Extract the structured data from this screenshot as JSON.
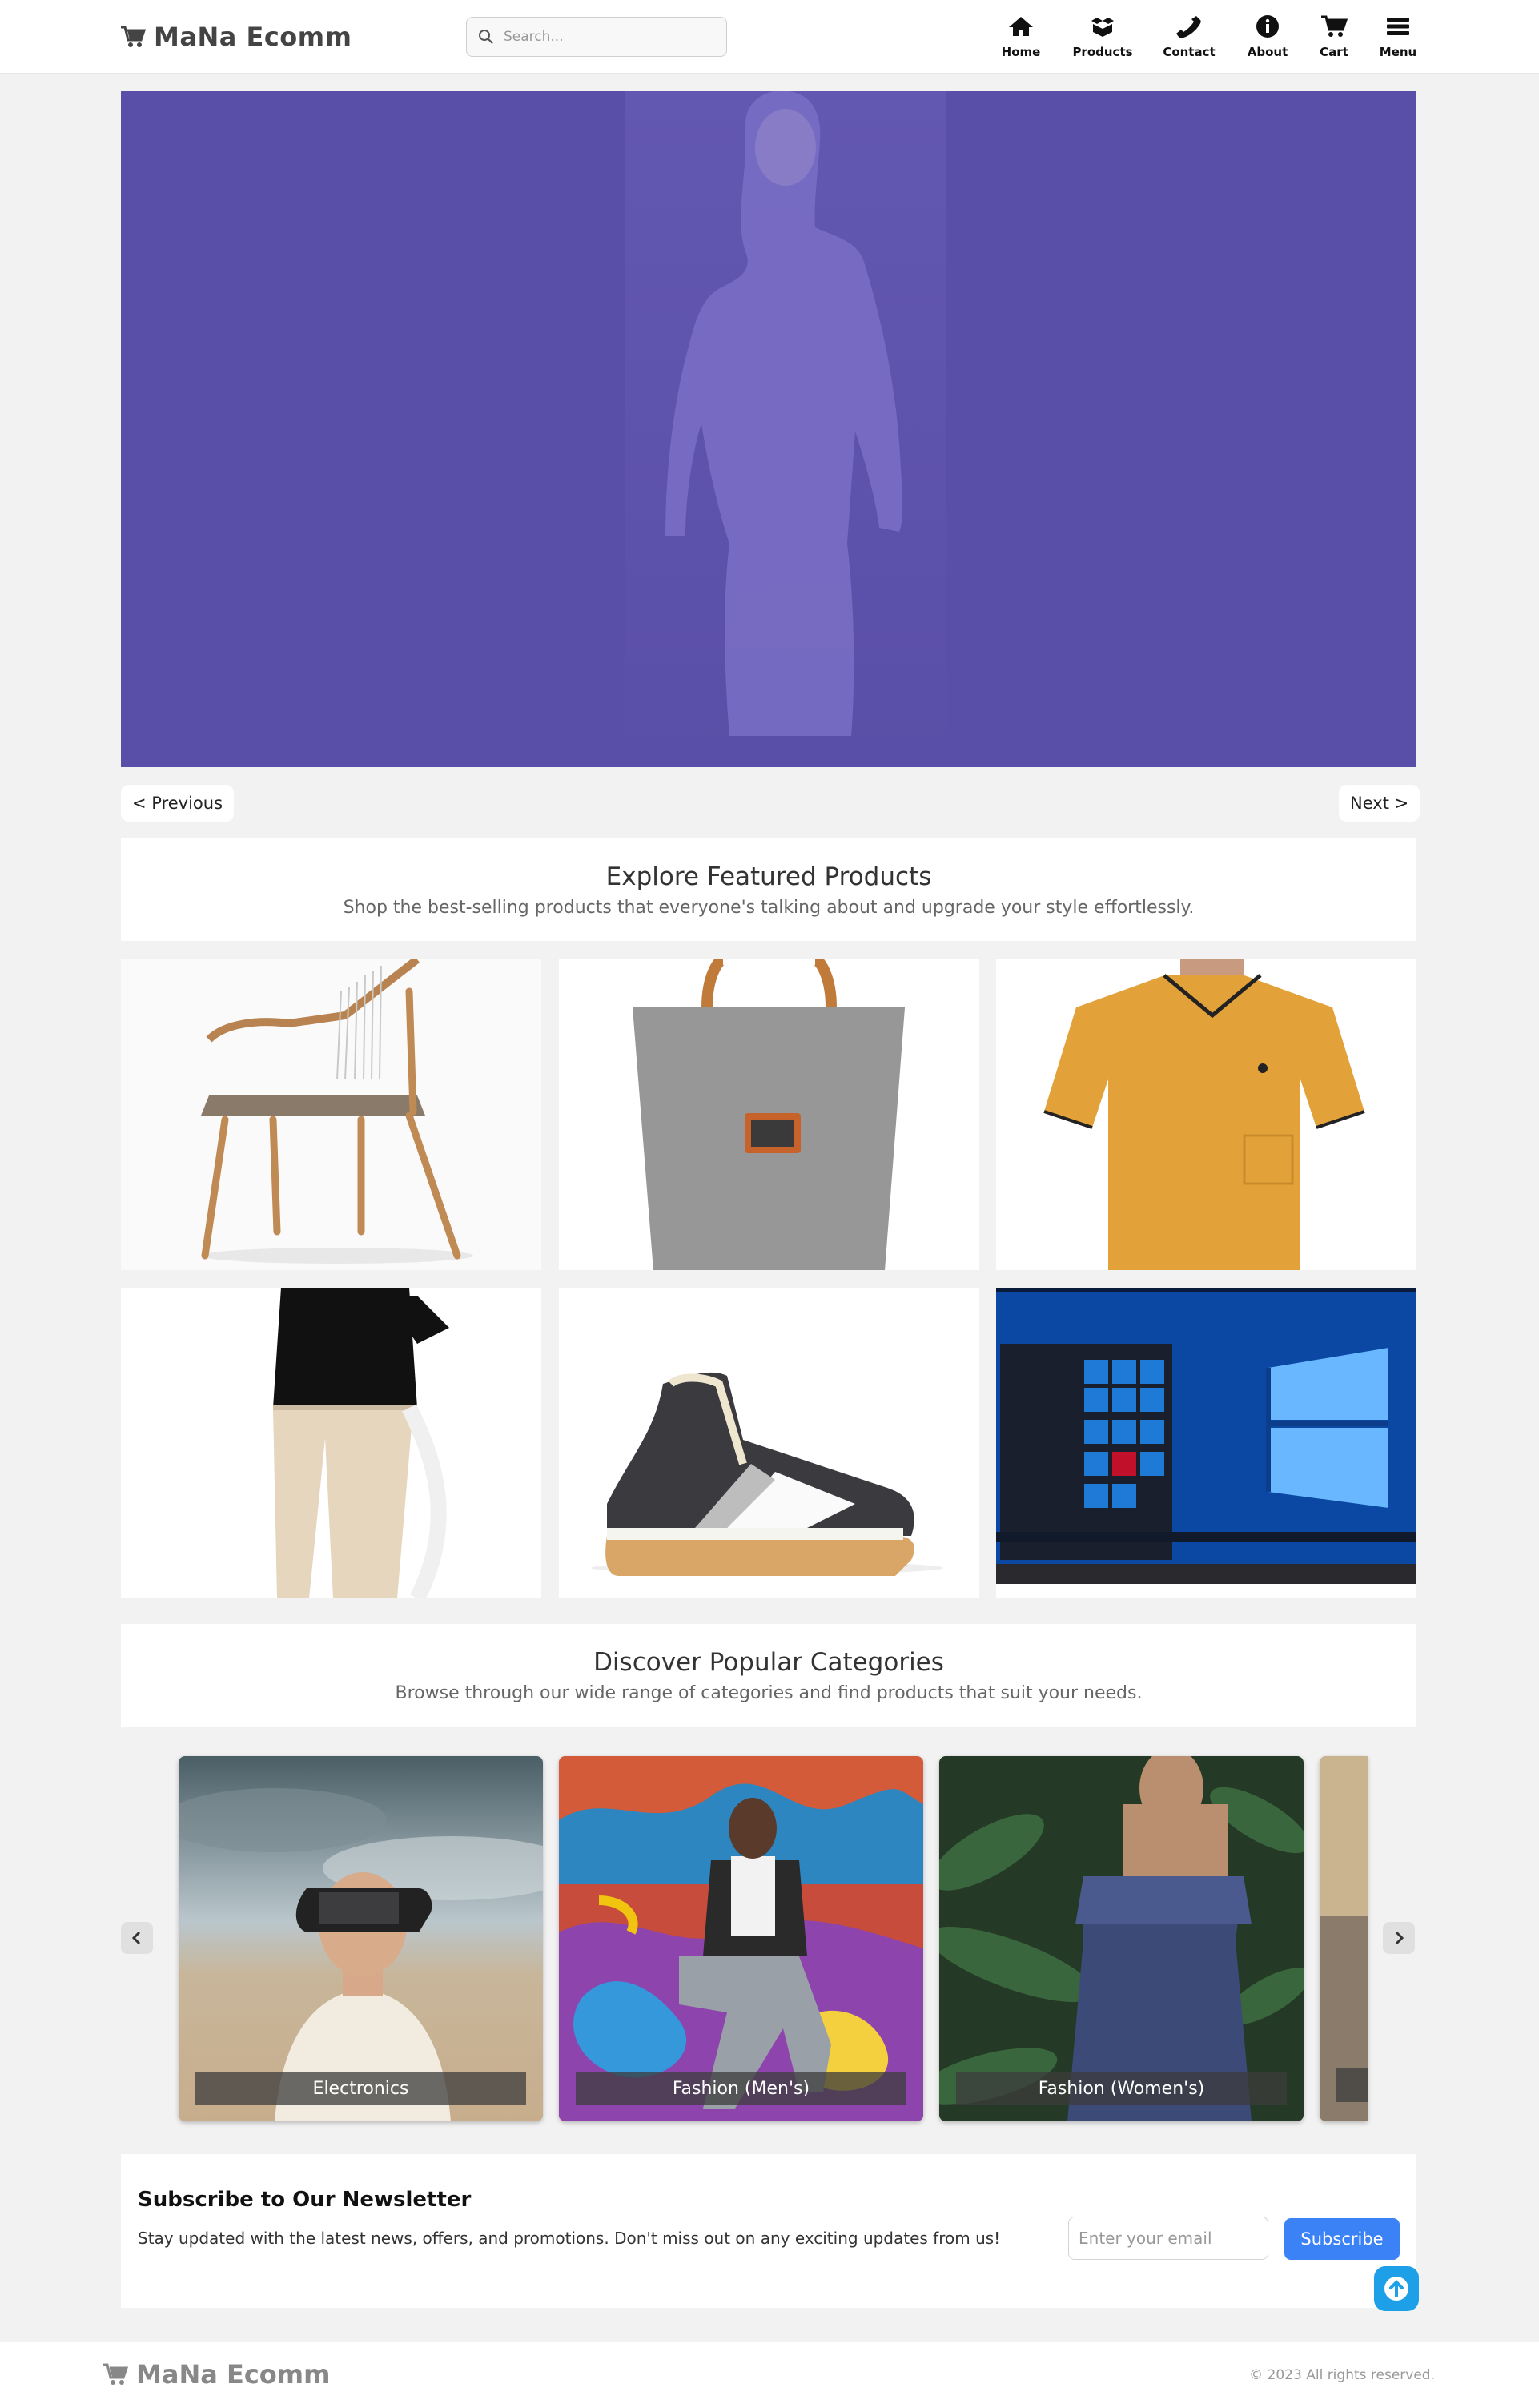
{
  "header": {
    "logo_text": "MaNa Ecomm",
    "search_placeholder": "Search...",
    "nav": [
      {
        "label": "Home",
        "icon": "home-icon"
      },
      {
        "label": "Products",
        "icon": "box-icon"
      },
      {
        "label": "Contact",
        "icon": "phone-icon"
      },
      {
        "label": "About",
        "icon": "info-icon"
      },
      {
        "label": "Cart",
        "icon": "cart-icon"
      },
      {
        "label": "Menu",
        "icon": "hamburger-icon"
      }
    ]
  },
  "hero": {
    "background_color": "#5a4fa8",
    "prev_label": "< Previous",
    "next_label": "Next >"
  },
  "featured": {
    "title": "Explore Featured Products",
    "subtitle": "Shop the best-selling products that everyone's talking about and upgrade your style effortlessly."
  },
  "categories": {
    "title": "Discover Popular Categories",
    "subtitle": "Browse through our wide range of categories and find products that suit your needs.",
    "items": [
      {
        "label": "Electronics"
      },
      {
        "label": "Fashion (Men's)"
      },
      {
        "label": "Fashion (Women's)"
      }
    ]
  },
  "newsletter": {
    "title": "Subscribe to Our Newsletter",
    "text": "Stay updated with the latest news, offers, and promotions. Don't miss out on any exciting updates from us!",
    "email_placeholder": "Enter your email",
    "button_label": "Subscribe"
  },
  "footer": {
    "logo_text": "MaNa Ecomm",
    "copyright": "© 2023 All rights reserved."
  },
  "colors": {
    "accent": "#3b82f6",
    "scroll_top": "#1ea0e8"
  }
}
